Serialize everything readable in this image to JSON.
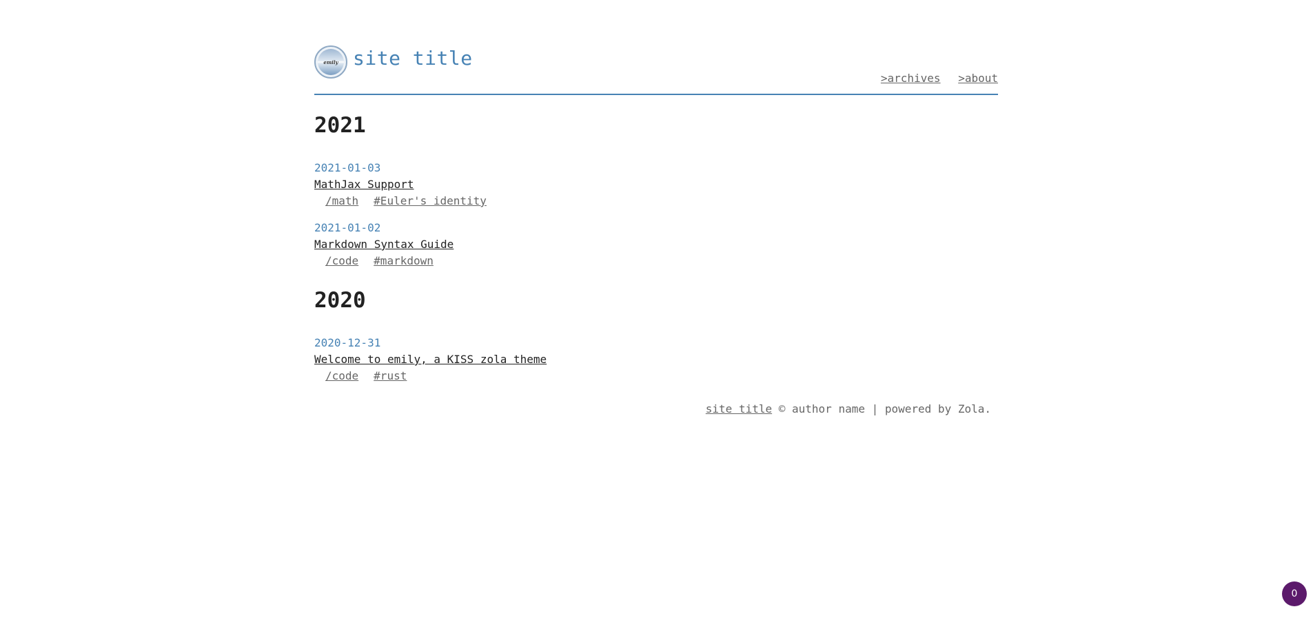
{
  "header": {
    "logo_text": "emily",
    "site_title": "site title",
    "nav": [
      {
        "label": ">archives"
      },
      {
        "label": ">about"
      }
    ]
  },
  "years": [
    {
      "year": "2021",
      "posts": [
        {
          "date": "2021-01-03",
          "title": "MathJax Support",
          "category": "/math",
          "tags": [
            "#Euler's identity"
          ]
        },
        {
          "date": "2021-01-02",
          "title": "Markdown Syntax Guide",
          "category": "/code",
          "tags": [
            "#markdown"
          ]
        }
      ]
    },
    {
      "year": "2020",
      "posts": [
        {
          "date": "2020-12-31",
          "title": "Welcome to emily, a KISS zola theme",
          "category": "/code",
          "tags": [
            "#rust"
          ]
        }
      ]
    }
  ],
  "footer": {
    "site_link": "site title",
    "text": " © author name | powered by Zola."
  },
  "badge": {
    "count": "0",
    "color": "#5c1a6b"
  },
  "colors": {
    "accent": "#4682b4",
    "muted": "#666666",
    "text": "#222222"
  }
}
